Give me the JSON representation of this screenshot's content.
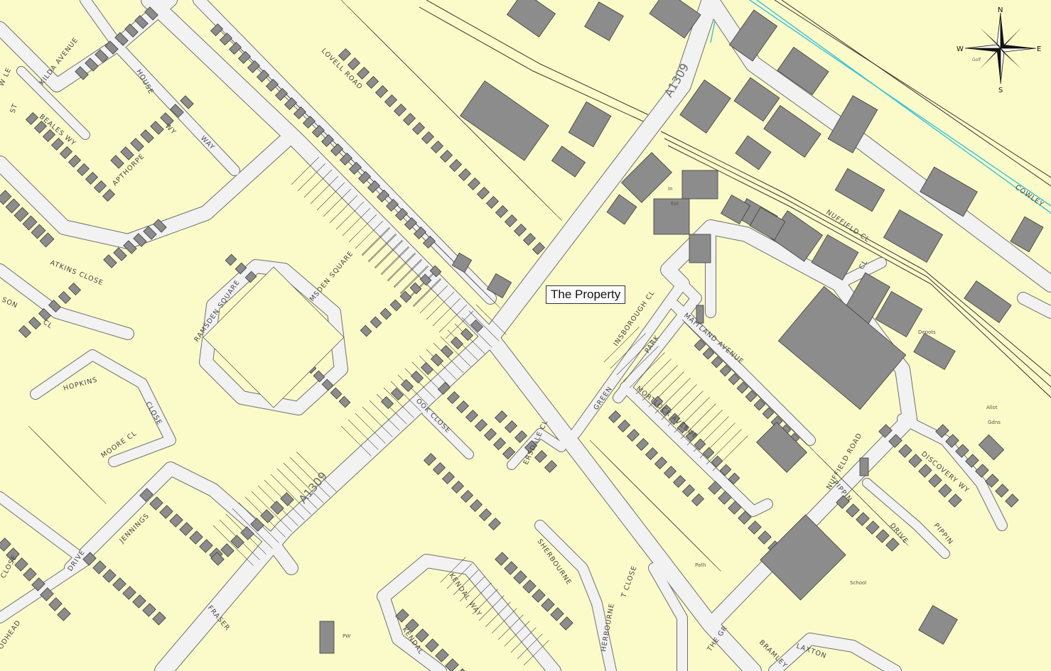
{
  "property_label": "The Property",
  "compass": {
    "n": "N",
    "s": "S",
    "e": "E",
    "w": "W",
    "overlay": "Golf"
  },
  "road_labels": [
    {
      "id": "kilda-avenue",
      "text": "KILDA  AVENUE"
    },
    {
      "id": "lovell-road",
      "text": "LOVELL  ROAD"
    },
    {
      "id": "ramsden-square",
      "text": "RAMSDEN  SQUARE"
    },
    {
      "id": "msden-square",
      "text": "MSDEN  SQUARE"
    },
    {
      "id": "house",
      "text": "HOUSE"
    },
    {
      "id": "wy-1",
      "text": "WY"
    },
    {
      "id": "way-1",
      "text": "WAY"
    },
    {
      "id": "apthorpe",
      "text": "APTHORPE"
    },
    {
      "id": "bealesway",
      "text": "BEALES WY"
    },
    {
      "id": "st",
      "text": "ST"
    },
    {
      "id": "atkins-close",
      "text": "ATKINS  CLOSE"
    },
    {
      "id": "son",
      "text": "SON"
    },
    {
      "id": "cl-1",
      "text": "CL"
    },
    {
      "id": "hopkins",
      "text": "HOPKINS"
    },
    {
      "id": "close-1",
      "text": "CLOSE"
    },
    {
      "id": "moore-cl",
      "text": "MOORE  CL"
    },
    {
      "id": "a1309-upper",
      "text": "A1309"
    },
    {
      "id": "a1309-lower",
      "text": "A1309"
    },
    {
      "id": "insborough-cl",
      "text": "INSBOROUGH  CL"
    },
    {
      "id": "maitland-avenue",
      "text": "MAITLAND  AVENUE"
    },
    {
      "id": "park",
      "text": "PARK"
    },
    {
      "id": "green",
      "text": "GREEN"
    },
    {
      "id": "mortlock-avenue",
      "text": "MORTLOCK  AVENUE"
    },
    {
      "id": "ook-close",
      "text": "OOK  CLOSE"
    },
    {
      "id": "ersdale-cl",
      "text": "ERSDALE CL"
    },
    {
      "id": "nuffield-cl",
      "text": "NUFFIELD  CL"
    },
    {
      "id": "nuffield-road",
      "text": "NUFFIELD  ROAD"
    },
    {
      "id": "nuffield-cl-2",
      "text": "CL"
    },
    {
      "id": "cowley",
      "text": "COWLEY"
    },
    {
      "id": "discovery-wy",
      "text": "DISCOVERY  WY"
    },
    {
      "id": "pippin",
      "text": "PIPPIN"
    },
    {
      "id": "drive-1",
      "text": "DRIVE"
    },
    {
      "id": "pippin-2",
      "text": "PIPPIN"
    },
    {
      "id": "sherbourne",
      "text": "SHERBOURNE"
    },
    {
      "id": "kendal-way",
      "text": "KENDAL  WAY"
    },
    {
      "id": "kendal",
      "text": "KENDAL"
    },
    {
      "id": "laxton",
      "text": "LAXTON"
    },
    {
      "id": "the-gr",
      "text": "THE  GR"
    },
    {
      "id": "fraser",
      "text": "FRASER"
    },
    {
      "id": "jennings",
      "text": "JENNINGS"
    },
    {
      "id": "drive-2",
      "text": "DRIVE"
    },
    {
      "id": "close-2",
      "text": "CLOSE"
    },
    {
      "id": "odhead",
      "text": "ODHEAD"
    },
    {
      "id": "t-close",
      "text": "T  CLOSE"
    },
    {
      "id": "herbourne",
      "text": "HERBOURNE"
    },
    {
      "id": "w-le",
      "text": "W  LE"
    },
    {
      "id": "bramley",
      "text": "BRAMLEY"
    }
  ],
  "area_labels": [
    {
      "id": "depots",
      "text": "Depots"
    },
    {
      "id": "school",
      "text": "School"
    },
    {
      "id": "in",
      "text": "In"
    },
    {
      "id": "est",
      "text": "Est"
    },
    {
      "id": "pw",
      "text": "PW"
    },
    {
      "id": "allot",
      "text": "Allot"
    },
    {
      "id": "gdns",
      "text": "Gdns"
    },
    {
      "id": "path",
      "text": "Path"
    }
  ]
}
